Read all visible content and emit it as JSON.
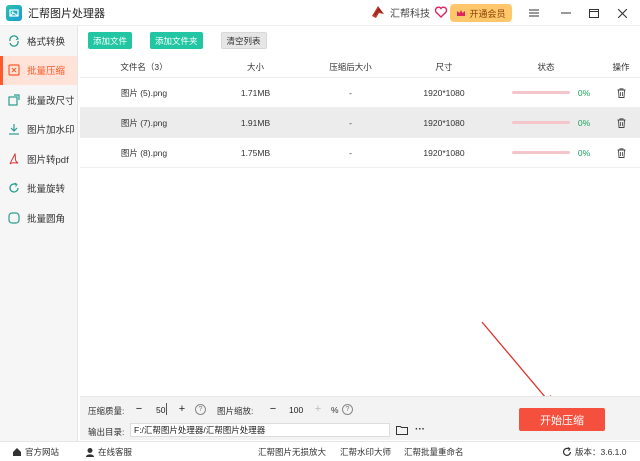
{
  "titlebar": {
    "app_title": "汇帮图片处理器",
    "brand_name": "汇帮科技",
    "vip_label": "开通会员"
  },
  "sidebar": {
    "items": [
      {
        "label": "格式转换",
        "icon": "format-icon",
        "active": false
      },
      {
        "label": "批量压缩",
        "icon": "compress-icon",
        "active": true
      },
      {
        "label": "批量改尺寸",
        "icon": "resize-icon",
        "active": false
      },
      {
        "label": "图片加水印",
        "icon": "watermark-icon",
        "active": false
      },
      {
        "label": "图片转pdf",
        "icon": "pdf-icon",
        "active": false
      },
      {
        "label": "批量旋转",
        "icon": "rotate-icon",
        "active": false
      },
      {
        "label": "批量圆角",
        "icon": "round-corner-icon",
        "active": false
      }
    ]
  },
  "toolbar": {
    "add_file": "添加文件",
    "add_folder": "添加文件夹",
    "clear_list": "清空列表"
  },
  "table": {
    "headers": [
      "文件名（3）",
      "大小",
      "压缩后大小",
      "尺寸",
      "状态",
      "操作"
    ],
    "rows": [
      {
        "name": "图片 (5).png",
        "size": "1.71MB",
        "compressed": "-",
        "dims": "1920*1080",
        "progress": "0%",
        "selected": false
      },
      {
        "name": "图片 (7).png",
        "size": "1.91MB",
        "compressed": "-",
        "dims": "1920*1080",
        "progress": "0%",
        "selected": true
      },
      {
        "name": "图片 (8).png",
        "size": "1.75MB",
        "compressed": "-",
        "dims": "1920*1080",
        "progress": "0%",
        "selected": false
      }
    ]
  },
  "settings": {
    "quality_label": "压缩质量:",
    "quality_value": "50",
    "scale_label": "图片缩放:",
    "scale_value": "100",
    "scale_unit": "%",
    "output_label": "输出目录:",
    "output_path": "F:/汇帮图片处理器/汇帮图片处理器",
    "more": "···"
  },
  "start_button": "开始压缩",
  "statusbar": {
    "website": "官方网站",
    "support": "在线客服",
    "link1": "汇帮图片无损放大",
    "link2": "汇帮水印大师",
    "link3": "汇帮批量重命名",
    "version": "版本：3.6.1.0"
  },
  "colors": {
    "accent": "#ff5a2b",
    "green": "#22c6a3",
    "start": "#f4503d",
    "vip": "#ffc76b"
  }
}
